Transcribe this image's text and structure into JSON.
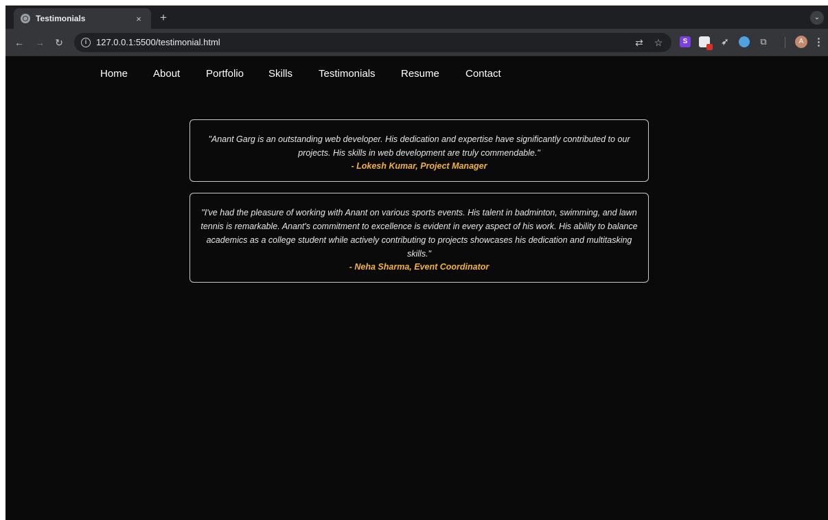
{
  "browser": {
    "tab_title": "Testimonials",
    "tab_close": "×",
    "new_tab": "+",
    "tab_menu": "⌄",
    "url": "127.0.0.1:5500/testimonial.html",
    "avatar_initial": "A",
    "extension_s_label": "S",
    "icons": [
      "back-icon",
      "forward-icon",
      "reload-icon",
      "site-info-icon",
      "translate-icon",
      "star-icon",
      "extension-s-icon",
      "extension-badge-icon",
      "rocket-icon",
      "extension-blue-icon",
      "puzzle-icon",
      "profile-avatar",
      "kebab-menu-icon"
    ]
  },
  "nav": {
    "items": [
      "Home",
      "About",
      "Portfolio",
      "Skills",
      "Testimonials",
      "Resume",
      "Contact"
    ]
  },
  "testimonials": [
    {
      "quote": "\"Anant Garg is an outstanding web developer. His dedication and expertise have significantly contributed to our projects. His skills in web development are truly commendable.\"",
      "author": "- Lokesh Kumar, Project Manager"
    },
    {
      "quote": "\"I've had the pleasure of working with Anant on various sports events. His talent in badminton, swimming, and lawn tennis is remarkable. Anant's commitment to excellence is evident in every aspect of his work. His ability to balance academics as a college student while actively contributing to projects showcases his dedication and multitasking skills.\"",
      "author": "- Neha Sharma, Event Coordinator"
    }
  ],
  "colors": {
    "page_background": "#0a0a0a",
    "author_accent": "#f3b338",
    "card_border": "#c9c9c9"
  }
}
